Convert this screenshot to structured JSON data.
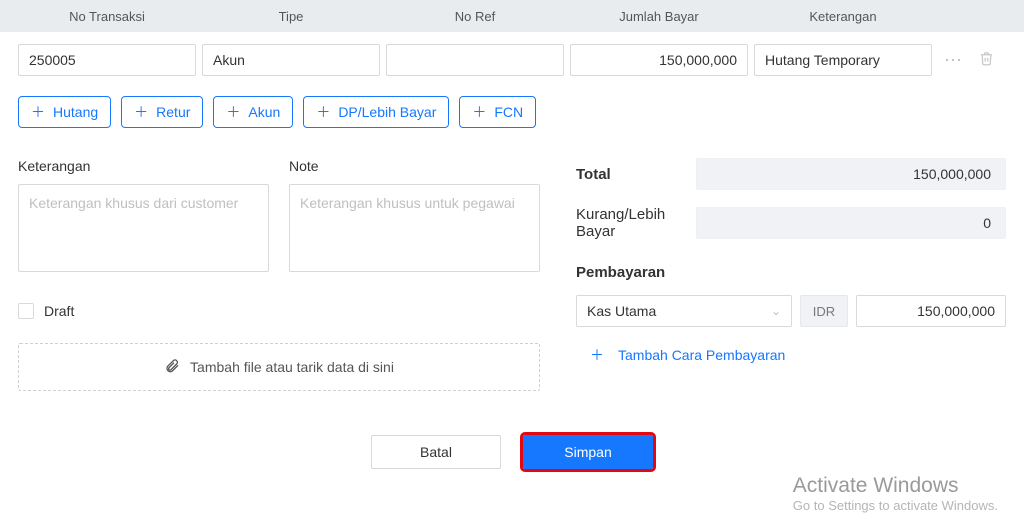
{
  "table": {
    "headers": {
      "trans": "No Transaksi",
      "tipe": "Tipe",
      "ref": "No Ref",
      "amount": "Jumlah Bayar",
      "ket": "Keterangan"
    },
    "row": {
      "trans": "250005",
      "tipe": "Akun",
      "ref": "",
      "amount": "150,000,000",
      "ket": "Hutang Temporary"
    }
  },
  "addButtons": {
    "hutang": "Hutang",
    "retur": "Retur",
    "akun": "Akun",
    "dp": "DP/Lebih Bayar",
    "fcn": "FCN"
  },
  "notes": {
    "keteranganLabel": "Keterangan",
    "noteLabel": "Note",
    "keteranganPlaceholder": "Keterangan khusus dari customer",
    "notePlaceholder": "Keterangan khusus untuk pegawai"
  },
  "draftLabel": "Draft",
  "dropzoneText": "Tambah file atau tarik data di sini",
  "totals": {
    "totalLabel": "Total",
    "totalValue": "150,000,000",
    "kurangLabel": "Kurang/Lebih Bayar",
    "kurangValue": "0"
  },
  "payment": {
    "sectionLabel": "Pembayaran",
    "account": "Kas Utama",
    "currency": "IDR",
    "amount": "150,000,000",
    "addLink": "Tambah Cara Pembayaran"
  },
  "footer": {
    "cancel": "Batal",
    "save": "Simpan"
  },
  "watermark": {
    "title": "Activate Windows",
    "sub": "Go to Settings to activate Windows."
  }
}
